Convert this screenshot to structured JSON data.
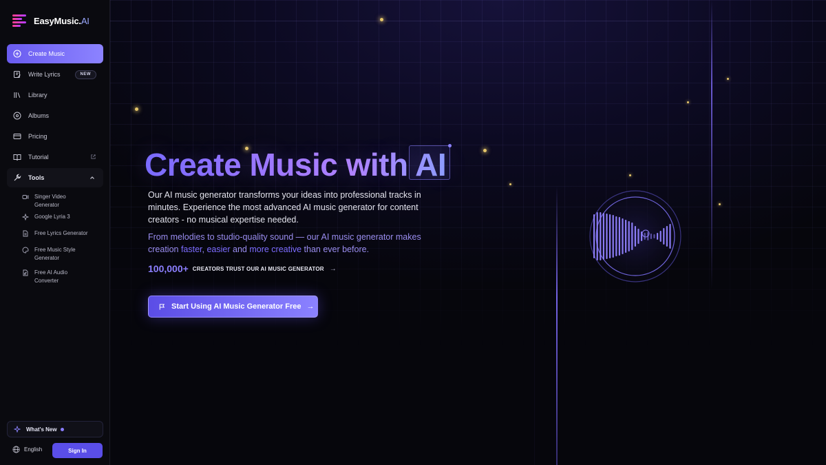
{
  "brand": {
    "name": "EasyMusic.",
    "name_suffix": "AI"
  },
  "sidebar": {
    "items": [
      {
        "label": "Create Music",
        "icon": "plus-circle-icon",
        "active": true
      },
      {
        "label": "Write Lyrics",
        "icon": "edit-icon",
        "badge": "NEW"
      },
      {
        "label": "Library",
        "icon": "library-icon"
      },
      {
        "label": "Albums",
        "icon": "disc-icon"
      },
      {
        "label": "Pricing",
        "icon": "card-icon"
      },
      {
        "label": "Tutorial",
        "icon": "book-icon",
        "external": true
      }
    ],
    "tools": {
      "label": "Tools",
      "icon": "wrench-icon",
      "items": [
        {
          "label": "Singer Video Generator",
          "icon": "video-icon"
        },
        {
          "label": "Google Lyria 3",
          "icon": "sparkle-icon"
        },
        {
          "label": "Free Lyrics Generator",
          "icon": "document-icon"
        },
        {
          "label": "Free Music Style Generator",
          "icon": "palette-icon"
        },
        {
          "label": "Free AI Audio Converter",
          "icon": "file-audio-icon"
        }
      ]
    },
    "whats_new": "What's New",
    "language": "English",
    "signin": "Sign In"
  },
  "hero": {
    "title": "Create Music with AI",
    "description": "Our AI music generator transforms your ideas into professional tracks in minutes. Experience the most advanced AI music generator for content creators - no musical expertise needed.",
    "sub": {
      "part1": "From melodies to studio-quality sound — our AI music generator makes creation ",
      "hl1": "faster",
      "sep1": ", ",
      "hl2": "easier",
      "sep2": " and ",
      "hl3": "more creative",
      "part2": " than ever before."
    },
    "trust_count": "100,000+",
    "trust_text": "CREATORS TRUST OUR AI MUSIC GENERATOR",
    "cta": "Start Using AI Music Generator Free"
  },
  "colors": {
    "accent": "#6a5cf0",
    "accent_light": "#8c83ff",
    "sparkle": "#e5c66a",
    "background": "#050509"
  }
}
